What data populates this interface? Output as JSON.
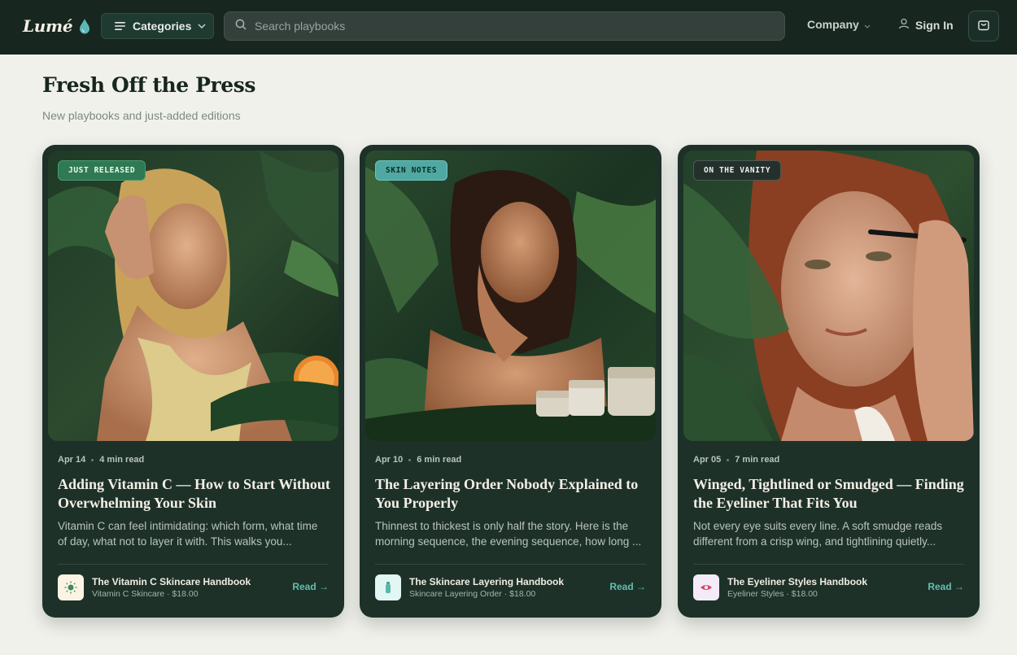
{
  "header": {
    "logo": "Lumé",
    "categories_label": "Categories",
    "search_placeholder": "Search playbooks",
    "company_label": "Company",
    "signin_label": "Sign In"
  },
  "section": {
    "title": "Fresh Off the Press",
    "subtitle": "New playbooks and just-added editions"
  },
  "cards": [
    {
      "tag": "JUST RELEASED",
      "tag_color": "#2f7a55",
      "date": "Apr 14",
      "read_time": "4 min read",
      "title": "Adding Vitamin C — How to Start Without Overwhelming Your Skin",
      "excerpt": "Vitamin C can feel intimidating: which form, what time of day, what not to layer it with. This walks you...",
      "book_title": "The Vitamin C Skincare Handbook",
      "book_sub": "Vitamin C Skincare · $18.00",
      "read_label": "Read →",
      "icon": "sun-icon"
    },
    {
      "tag": "SKIN NOTES",
      "tag_color": "#4fa9a2",
      "date": "Apr 10",
      "read_time": "6 min read",
      "title": "The Layering Order Nobody Explained to You Properly",
      "excerpt": "Thinnest to thickest is only half the story. Here is the morning sequence, the evening sequence, how long ...",
      "book_title": "The Skincare Layering Handbook",
      "book_sub": "Skincare Layering Order · $18.00",
      "read_label": "Read →",
      "icon": "serum-bottle-icon"
    },
    {
      "tag": "ON THE VANITY",
      "tag_color": "#24302b",
      "date": "Apr 05",
      "read_time": "7 min read",
      "title": "Winged, Tightlined or Smudged — Finding the Eyeliner That Fits You",
      "excerpt": "Not every eye suits every line. A soft smudge reads different from a crisp wing, and tightlining quietly...",
      "book_title": "The Eyeliner Styles Handbook",
      "book_sub": "Eyeliner Styles · $18.00",
      "read_label": "Read →",
      "icon": "eye-icon"
    }
  ]
}
